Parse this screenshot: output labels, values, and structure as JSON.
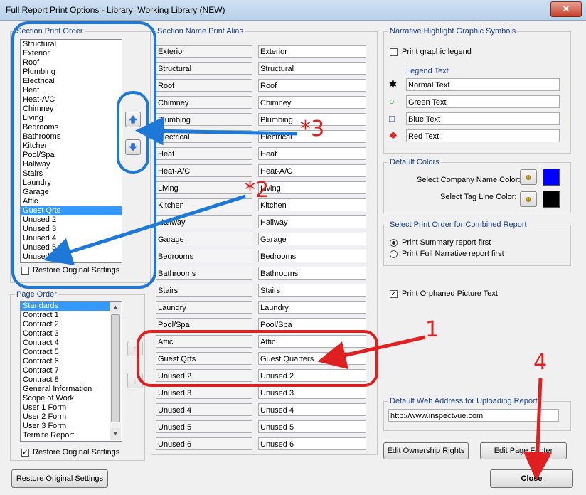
{
  "window": {
    "title": "Full Report Print Options - Library: Working Library (NEW)",
    "close_glyph": "✕"
  },
  "section_print_order": {
    "legend": "Section Print Order",
    "items": [
      "Structural",
      "Exterior",
      "Roof",
      "Plumbing",
      "Electrical",
      "Heat",
      "Heat-A/C",
      "Chimney",
      "Living",
      "Bedrooms",
      "Bathrooms",
      "Kitchen",
      "Pool/Spa",
      "Hallway",
      "Stairs",
      "Laundry",
      "Garage",
      "Attic",
      "Guest Qrts",
      "Unused 2",
      "Unused 3",
      "Unused 4",
      "Unused 5",
      "Unused 6"
    ],
    "selected_index": 18,
    "restore_label": "Restore Original Settings"
  },
  "page_order": {
    "legend": "Page Order",
    "items": [
      "Standards",
      "Contract 1",
      "Contract 2",
      "Contract 3",
      "Contract 4",
      "Contract 5",
      "Contract 6",
      "Contract 7",
      "Contract 8",
      "General Information",
      "Scope of Work",
      "User 1 Form",
      "User 2 Form",
      "User 3 Form",
      "Termite Report"
    ],
    "selected_index": 0,
    "restore_label": "Restore Original Settings"
  },
  "section_alias": {
    "legend": "Section Name Print Alias",
    "rows": [
      {
        "name": "Exterior",
        "alias": "Exterior"
      },
      {
        "name": "Structural",
        "alias": "Structural"
      },
      {
        "name": "Roof",
        "alias": "Roof"
      },
      {
        "name": "Chimney",
        "alias": "Chimney"
      },
      {
        "name": "Plumbing",
        "alias": "Plumbing"
      },
      {
        "name": "Electrical",
        "alias": "Electrical"
      },
      {
        "name": "Heat",
        "alias": "Heat"
      },
      {
        "name": "Heat-A/C",
        "alias": "Heat-A/C"
      },
      {
        "name": "Living",
        "alias": "Living"
      },
      {
        "name": "Kitchen",
        "alias": "Kitchen"
      },
      {
        "name": "Hallway",
        "alias": "Hallway"
      },
      {
        "name": "Garage",
        "alias": "Garage"
      },
      {
        "name": "Bedrooms",
        "alias": "Bedrooms"
      },
      {
        "name": "Bathrooms",
        "alias": "Bathrooms"
      },
      {
        "name": "Stairs",
        "alias": "Stairs"
      },
      {
        "name": "Laundry",
        "alias": "Laundry"
      },
      {
        "name": "Pool/Spa",
        "alias": "Pool/Spa"
      },
      {
        "name": "Attic",
        "alias": "Attic"
      },
      {
        "name": "Guest Qrts",
        "alias": "Guest Quarters"
      },
      {
        "name": "Unused 2",
        "alias": "Unused 2"
      },
      {
        "name": "Unused 3",
        "alias": "Unused 3"
      },
      {
        "name": "Unused 4",
        "alias": "Unused 4"
      },
      {
        "name": "Unused 5",
        "alias": "Unused 5"
      },
      {
        "name": "Unused 6",
        "alias": "Unused 6"
      }
    ]
  },
  "narrative": {
    "legend": "Narrative Highlight Graphic Symbols",
    "print_legend_label": "Print graphic legend",
    "print_legend_checked": false,
    "legend_text_label": "Legend Text",
    "entries": [
      {
        "symbol": "✱",
        "color": "#000000",
        "text": "Normal Text"
      },
      {
        "symbol": "○",
        "color": "#22aa22",
        "text": "Green Text"
      },
      {
        "symbol": "□",
        "color": "#1a3fd0",
        "text": "Blue Text"
      },
      {
        "symbol": "❖",
        "color": "#e02020",
        "text": "Red Text"
      }
    ]
  },
  "default_colors": {
    "legend": "Default Colors",
    "company_label": "Select Company Name Color:",
    "company_color": "#0000ff",
    "tagline_label": "Select Tag Line Color:",
    "tagline_color": "#000000",
    "picker_icon": "color-picker-icon"
  },
  "combined_report": {
    "legend": "Select Print Order for Combined Report",
    "options": [
      "Print Summary report first",
      "Print Full Narrative report first"
    ],
    "selected_index": 0
  },
  "orphaned": {
    "label": "Print Orphaned Picture Text",
    "checked": true
  },
  "web_address": {
    "legend": "Default Web Address for Uploading Reports",
    "value": "http://www.inspectvue.com"
  },
  "buttons": {
    "edit_ownership": "Edit Ownership Rights",
    "edit_footer": "Edit Page Footer",
    "restore_bottom": "Restore Original Settings",
    "close": "Close"
  },
  "annotations": {
    "n1": "1",
    "n2": "*2",
    "n3": "*3",
    "n4": "4"
  },
  "colors": {
    "annotation_red": "#e02020",
    "annotation_blue": "#1e78d8",
    "selection": "#3399ff"
  }
}
